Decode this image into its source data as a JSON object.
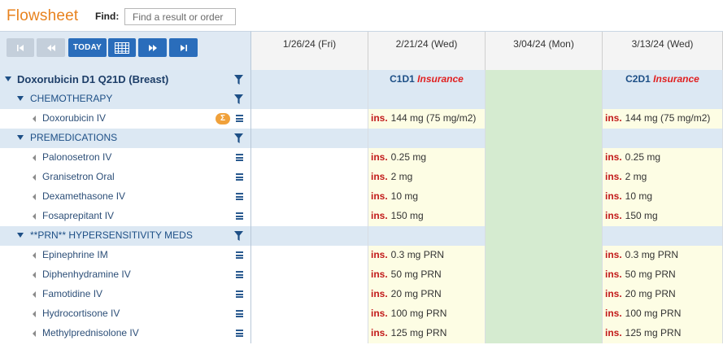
{
  "app": {
    "title": "Flowsheet"
  },
  "find": {
    "label": "Find:",
    "placeholder": "Find a result or order"
  },
  "nav": {
    "today_label": "TODAY"
  },
  "dates": [
    "1/26/24 (Fri)",
    "2/21/24 (Wed)",
    "3/04/24 (Mon)",
    "3/13/24 (Wed)"
  ],
  "colors": {
    "accent_orange": "#e8821e",
    "nav_blue": "#2a6dbb",
    "insurance_red": "#e02020",
    "green_col": "#d5ebd0",
    "yellow_cell": "#fdfde4",
    "group_band": "#dce8f3"
  },
  "rows": [
    {
      "type": "plan",
      "label": "Doxorubicin D1 Q21D (Breast)",
      "cycles": [
        "",
        "C1D1",
        "",
        "C2D1"
      ],
      "cycle_note": "Insurance"
    },
    {
      "type": "group",
      "label": "CHEMOTHERAPY"
    },
    {
      "type": "item",
      "label": "Doxorubicin IV",
      "sigma": "Σ",
      "doses": [
        "",
        "144 mg (75 mg/m2)",
        "",
        "144 mg (75 mg/m2)"
      ]
    },
    {
      "type": "group",
      "label": "PREMEDICATIONS"
    },
    {
      "type": "item",
      "label": "Palonosetron IV",
      "doses": [
        "",
        "0.25 mg",
        "",
        "0.25 mg"
      ]
    },
    {
      "type": "item",
      "label": "Granisetron Oral",
      "doses": [
        "",
        "2 mg",
        "",
        "2 mg"
      ]
    },
    {
      "type": "item",
      "label": "Dexamethasone IV",
      "doses": [
        "",
        "10 mg",
        "",
        "10 mg"
      ]
    },
    {
      "type": "item",
      "label": "Fosaprepitant IV",
      "doses": [
        "",
        "150 mg",
        "",
        "150 mg"
      ]
    },
    {
      "type": "group",
      "label": "**PRN** HYPERSENSITIVITY MEDS"
    },
    {
      "type": "item",
      "label": "Epinephrine IM",
      "doses": [
        "",
        "0.3 mg PRN",
        "",
        "0.3 mg PRN"
      ]
    },
    {
      "type": "item",
      "label": "Diphenhydramine IV",
      "doses": [
        "",
        "50 mg PRN",
        "",
        "50 mg PRN"
      ]
    },
    {
      "type": "item",
      "label": "Famotidine IV",
      "doses": [
        "",
        "20 mg PRN",
        "",
        "20 mg PRN"
      ]
    },
    {
      "type": "item",
      "label": "Hydrocortisone IV",
      "doses": [
        "",
        "100 mg PRN",
        "",
        "100 mg PRN"
      ]
    },
    {
      "type": "item",
      "label": "Methylprednisolone IV",
      "doses": [
        "",
        "125 mg PRN",
        "",
        "125 mg PRN"
      ]
    }
  ],
  "ins_tag": "ins."
}
